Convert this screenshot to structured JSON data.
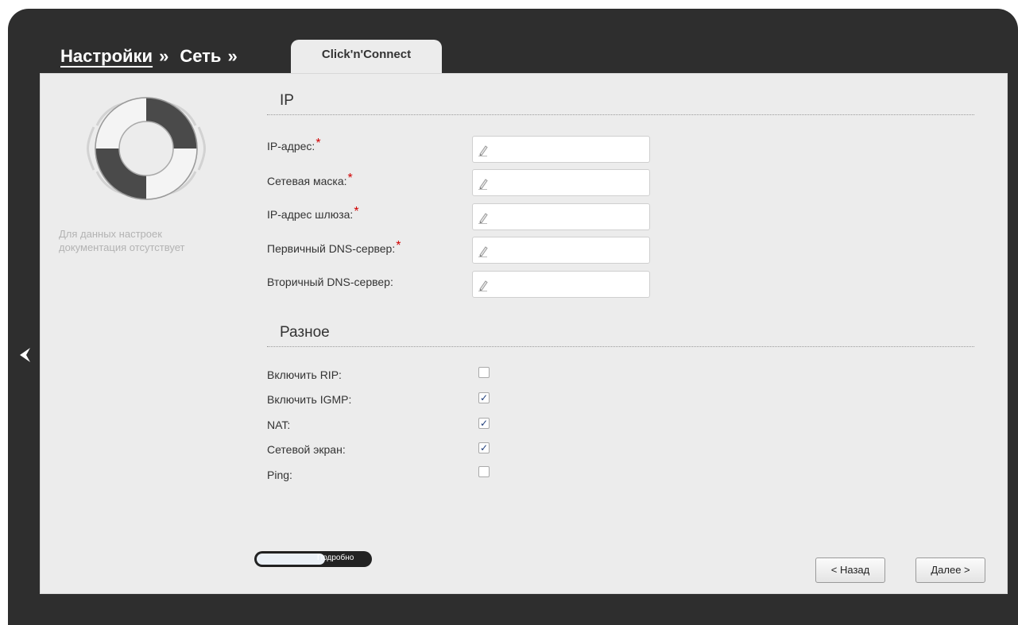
{
  "breadcrumb": {
    "settings": "Настройки",
    "settings_sep": "»",
    "network": "Сеть",
    "network_sep": "»"
  },
  "tab": {
    "label": "Click'n'Connect"
  },
  "help": {
    "text": "Для данных настроек документация отсутствует"
  },
  "ip_section": {
    "title": "IP",
    "fields": [
      {
        "label": "IP-адрес:",
        "required": "*",
        "value": ""
      },
      {
        "label": "Сетевая маска:",
        "required": "*",
        "value": ""
      },
      {
        "label": "IP-адрес шлюза:",
        "required": "*",
        "value": ""
      },
      {
        "label": "Первичный DNS-сервер:",
        "required": "*",
        "value": ""
      },
      {
        "label": "Вторичный DNS-сервер:",
        "required": "",
        "value": ""
      }
    ]
  },
  "misc_section": {
    "title": "Разное",
    "options": [
      {
        "label": "Включить RIP:",
        "checked": false
      },
      {
        "label": "Включить IGMP:",
        "checked": true
      },
      {
        "label": "NAT:",
        "checked": true
      },
      {
        "label": "Сетевой экран:",
        "checked": true
      },
      {
        "label": "Ping:",
        "checked": false
      }
    ]
  },
  "toggle": {
    "label": "Подробно"
  },
  "buttons": {
    "back": "< Назад",
    "next": "Далее >"
  },
  "colors": {
    "frame": "#2e2e2e",
    "panel": "#ececec",
    "required": "#d00000",
    "check": "#1d3d7a"
  },
  "icons": {
    "help": "lifebuoy-icon",
    "field": "pencil-icon",
    "nav": "arrow-left-icon"
  }
}
